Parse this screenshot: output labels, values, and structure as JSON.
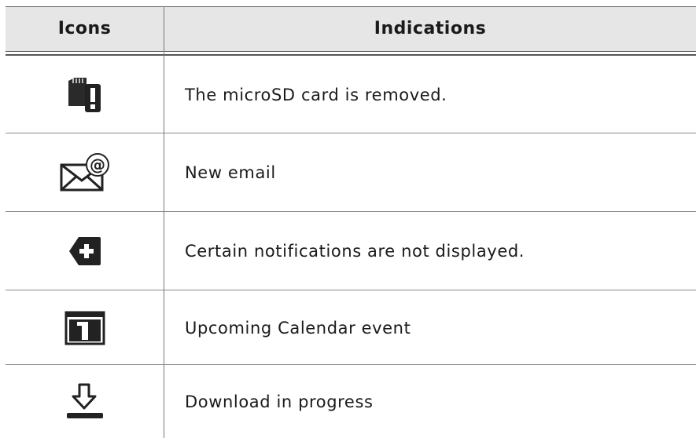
{
  "header": {
    "icons_label": "Icons",
    "indications_label": "Indications"
  },
  "rows": [
    {
      "icon": "microsd-removed-icon",
      "text": "The microSD card is removed."
    },
    {
      "icon": "new-email-icon",
      "text": "New email"
    },
    {
      "icon": "notifications-hidden-icon",
      "text": "Certain notifications are not displayed."
    },
    {
      "icon": "calendar-event-icon",
      "text": "Upcoming Calendar event"
    },
    {
      "icon": "download-progress-icon",
      "text": "Download in progress"
    }
  ]
}
